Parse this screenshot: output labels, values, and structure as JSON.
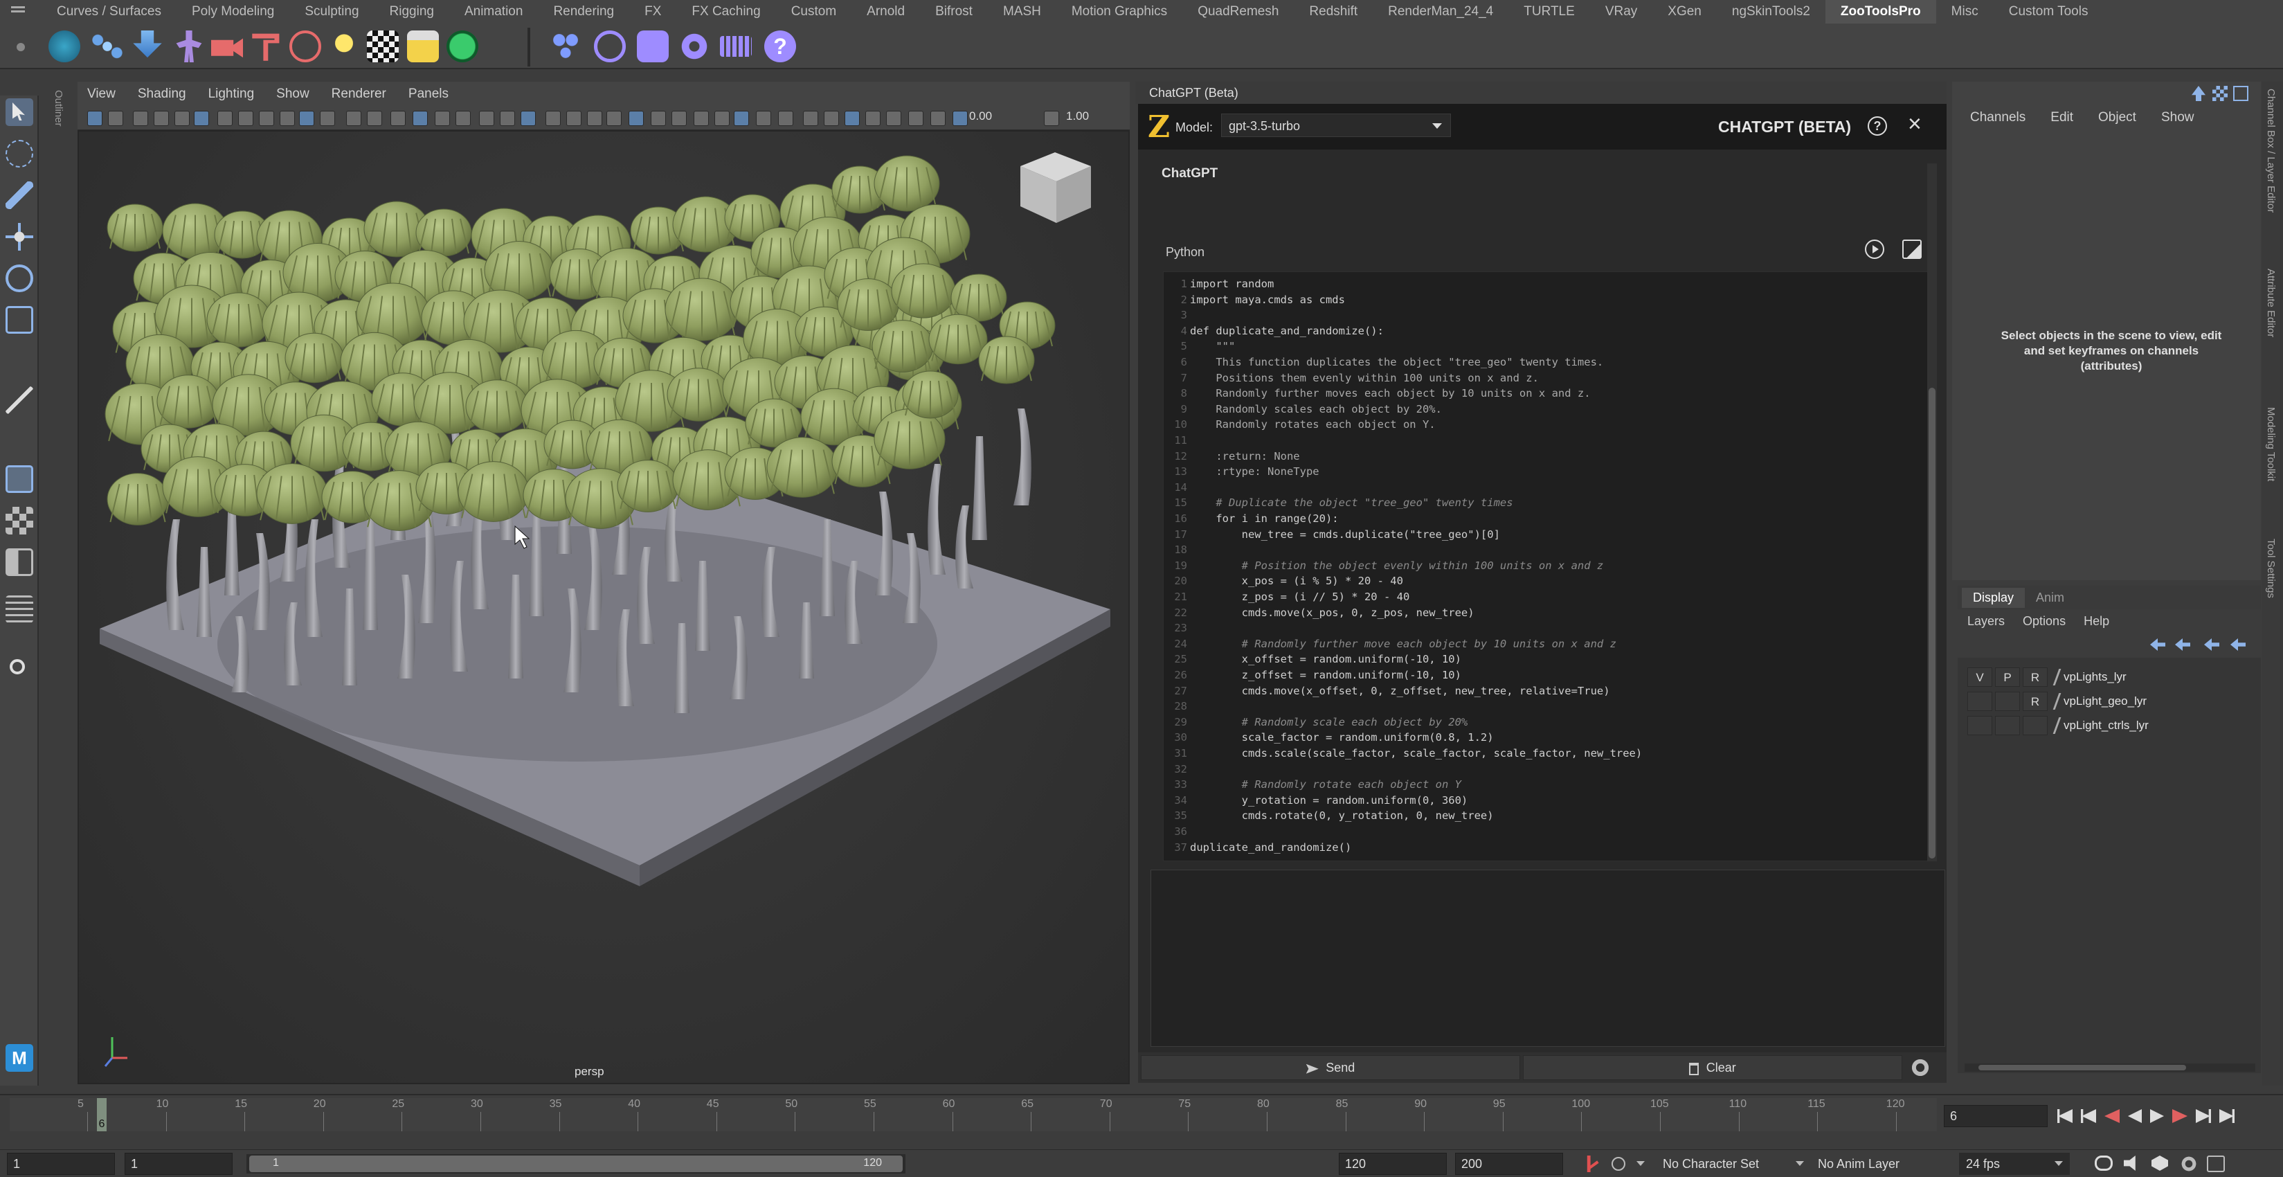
{
  "shelf": {
    "tabs": [
      "Curves / Surfaces",
      "Poly Modeling",
      "Sculpting",
      "Rigging",
      "Animation",
      "Rendering",
      "FX",
      "FX Caching",
      "Custom",
      "Arnold",
      "Bifrost",
      "MASH",
      "Motion Graphics",
      "QuadRemesh",
      "Redshift",
      "RenderMan_24_4",
      "TURTLE",
      "VRay",
      "XGen",
      "ngSkinTools2",
      "ZooToolsPro",
      "Misc",
      "Custom Tools"
    ],
    "active_tab": "ZooToolsPro"
  },
  "viewport": {
    "menu": [
      "View",
      "Shading",
      "Lighting",
      "Show",
      "Renderer",
      "Panels"
    ],
    "toolbar_value_1": "0.00",
    "toolbar_value_2": "1.00",
    "camera_label": "persp",
    "outliner_label": "Outliner"
  },
  "chat": {
    "window_title": "ChatGPT (Beta)",
    "logo": "Z",
    "model_label": "Model:",
    "model_value": "gpt-3.5-turbo",
    "header_title": "CHATGPT (BETA)",
    "speaker": "ChatGPT",
    "code_language": "Python",
    "code_lines": [
      "import random",
      "import maya.cmds as cmds",
      "",
      "def duplicate_and_randomize():",
      "    \"\"\"",
      "    This function duplicates the object \"tree_geo\" twenty times.",
      "    Positions them evenly within 100 units on x and z.",
      "    Randomly further moves each object by 10 units on x and z.",
      "    Randomly scales each object by 20%.",
      "    Randomly rotates each object on Y.",
      "",
      "    :return: None",
      "    :rtype: NoneType",
      "",
      "    # Duplicate the object \"tree_geo\" twenty times",
      "    for i in range(20):",
      "        new_tree = cmds.duplicate(\"tree_geo\")[0]",
      "",
      "        # Position the object evenly within 100 units on x and z",
      "        x_pos = (i % 5) * 20 - 40",
      "        z_pos = (i // 5) * 20 - 40",
      "        cmds.move(x_pos, 0, z_pos, new_tree)",
      "",
      "        # Randomly further move each object by 10 units on x and z",
      "        x_offset = random.uniform(-10, 10)",
      "        z_offset = random.uniform(-10, 10)",
      "        cmds.move(x_offset, 0, z_offset, new_tree, relative=True)",
      "",
      "        # Randomly scale each object by 20%",
      "        scale_factor = random.uniform(0.8, 1.2)",
      "        cmds.scale(scale_factor, scale_factor, scale_factor, new_tree)",
      "",
      "        # Randomly rotate each object on Y",
      "        y_rotation = random.uniform(0, 360)",
      "        cmds.rotate(0, y_rotation, 0, new_tree)",
      "",
      "duplicate_and_randomize()"
    ],
    "send_label": "Send",
    "clear_label": "Clear"
  },
  "channel_box": {
    "menu": [
      "Channels",
      "Edit",
      "Object",
      "Show"
    ],
    "empty_message": "Select objects in the scene to view, edit and set keyframes on channels (attributes)"
  },
  "layer_editor": {
    "tabs": [
      "Display",
      "Anim"
    ],
    "menu": [
      "Layers",
      "Options",
      "Help"
    ],
    "layers": [
      {
        "v": "V",
        "p": "P",
        "r": "R",
        "name": "vpLights_lyr"
      },
      {
        "v": "",
        "p": "",
        "r": "R",
        "name": "vpLight_geo_lyr"
      },
      {
        "v": "",
        "p": "",
        "r": "",
        "name": "vpLight_ctrls_lyr"
      }
    ]
  },
  "side_tabs": [
    "Channel Box / Layer Editor",
    "Attribute Editor",
    "Modeling Toolkit",
    "Tool Settings"
  ],
  "timeline": {
    "ticks": [
      "5",
      "10",
      "15",
      "20",
      "25",
      "30",
      "35",
      "40",
      "45",
      "50",
      "55",
      "60",
      "65",
      "70",
      "75",
      "80",
      "85",
      "90",
      "95",
      "100",
      "105",
      "110",
      "115",
      "120"
    ],
    "current_frame_marker": "6",
    "current_frame_field": "6",
    "range_start": "1",
    "range_start_inner": "1",
    "range_slider_start": "1",
    "range_slider_end": "120",
    "range_end_inner": "120",
    "range_end": "200",
    "character_set": "No Character Set",
    "anim_layer": "No Anim Layer",
    "fps": "24 fps"
  }
}
